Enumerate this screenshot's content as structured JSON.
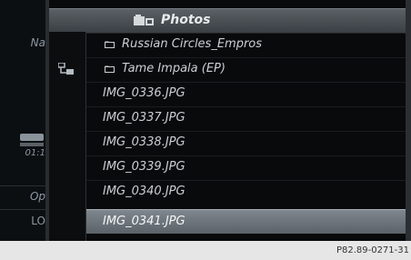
{
  "header": {
    "title": "Photos",
    "title_icon": "photo-folder-icon"
  },
  "sidebar": {
    "items": [
      {
        "label": "Na"
      },
      {
        "label": "01:1"
      },
      {
        "label": "Op"
      },
      {
        "label": "LO"
      }
    ]
  },
  "browse_icon": "folder-tree-icon",
  "list": {
    "folders": [
      {
        "label": "Russian Circles_Empros"
      },
      {
        "label": "Tame Impala (EP)"
      }
    ],
    "files": [
      {
        "label": "IMG_0336.JPG"
      },
      {
        "label": "IMG_0337.JPG"
      },
      {
        "label": "IMG_0338.JPG"
      },
      {
        "label": "IMG_0339.JPG"
      },
      {
        "label": "IMG_0340.JPG"
      },
      {
        "label": "IMG_0341.JPG",
        "selected": true
      }
    ]
  },
  "caption": "P82.89-0271-31",
  "colors": {
    "selection": "#6e767d",
    "background": "#090a0b",
    "text": "#c9cfd4"
  }
}
